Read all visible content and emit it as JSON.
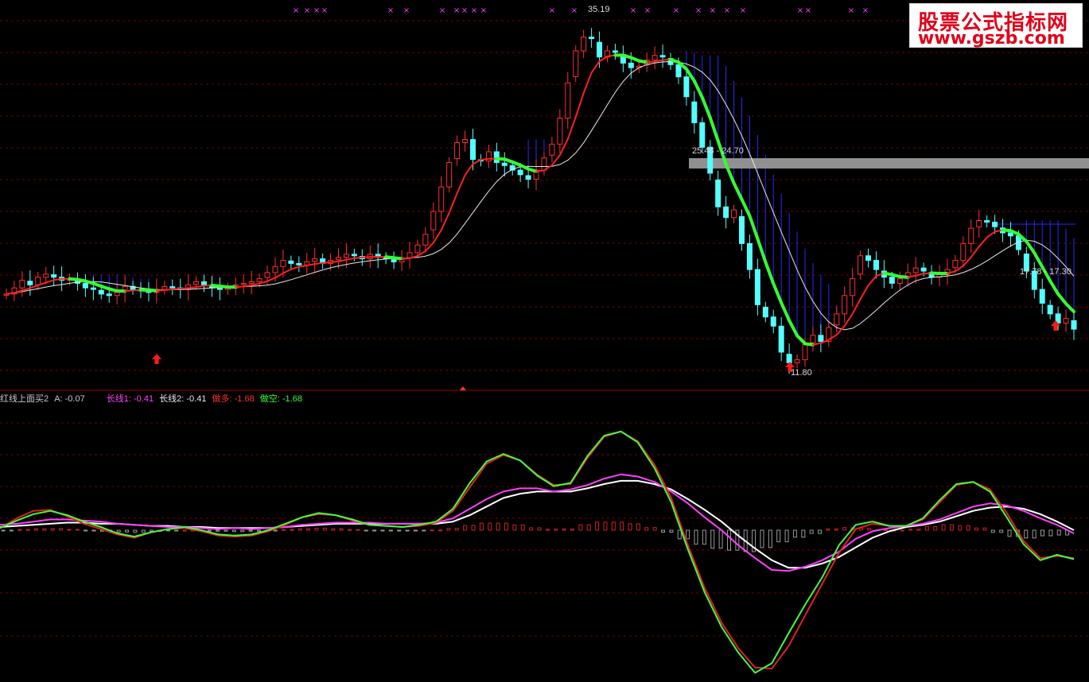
{
  "logo": {
    "line1": "股票公式指标网",
    "line2": "www.gszb.com"
  },
  "status": {
    "title": "红线上面买2",
    "a": "A: -0.07",
    "long1": "长线1: -0.41",
    "long2": "长线2: -0.41",
    "buy": "做多: -1.68",
    "sell": "做空: -1.68"
  },
  "annotations": {
    "high": "35.19",
    "low": "11.80",
    "zone1": "25.48 - 24.70",
    "zone2": "17.78 - 17.30"
  },
  "colors": {
    "up": "#ff3030",
    "down": "#54ffff",
    "fast_red": "#ff2020",
    "fast_green": "#33ff33",
    "slow": "#e8e8e8",
    "band": "#2828ff",
    "grid": "#7a0000",
    "magenta": "#ff40ff",
    "orange": "#ff9020"
  },
  "chart_data": {
    "type": "candlestick",
    "price_high": 35.19,
    "price_low": 11.8,
    "closes": [
      16.9,
      17.3,
      17.8,
      17.5,
      18.0,
      18.2,
      18.0,
      17.8,
      17.9,
      17.6,
      17.3,
      17.2,
      16.9,
      16.8,
      17.0,
      17.4,
      17.2,
      17.1,
      17.0,
      17.2,
      17.4,
      17.3,
      17.2,
      17.5,
      17.7,
      17.5,
      17.3,
      17.2,
      17.3,
      17.5,
      17.6,
      17.7,
      17.9,
      18.3,
      18.7,
      19.1,
      18.9,
      18.8,
      19.0,
      19.2,
      18.9,
      19.1,
      19.3,
      19.5,
      19.4,
      19.2,
      19.5,
      19.3,
      19.2,
      19.0,
      19.2,
      19.6,
      20.1,
      20.8,
      22.3,
      23.9,
      25.5,
      26.8,
      27.0,
      25.7,
      25.6,
      26.2,
      25.5,
      25.3,
      25.0,
      24.7,
      24.4,
      25.0,
      25.8,
      26.7,
      28.4,
      30.7,
      32.8,
      33.7,
      33.6,
      32.4,
      32.8,
      32.7,
      32.0,
      31.7,
      31.8,
      32.2,
      32.5,
      32.4,
      31.9,
      31.1,
      29.8,
      28.1,
      26.5,
      24.8,
      22.6,
      21.9,
      22.4,
      20.2,
      18.5,
      16.2,
      15.4,
      14.8,
      13.1,
      12.4,
      12.6,
      13.6,
      14.2,
      13.8,
      14.7,
      15.6,
      16.8,
      17.9,
      19.4,
      19.1,
      18.5,
      18.0,
      17.6,
      17.9,
      18.3,
      18.6,
      18.4,
      18.0,
      18.2,
      18.5,
      19.1,
      20.2,
      21.2,
      21.7,
      21.6,
      21.3,
      20.9,
      20.7,
      19.8,
      18.4,
      17.2,
      16.3,
      15.6,
      15.0,
      15.3,
      14.6
    ]
  },
  "oscillator": {
    "fast1": [
      0.2,
      0.9,
      1.5,
      1.8,
      1.4,
      0.8,
      0.3,
      -0.3,
      -0.6,
      -0.2,
      0.1,
      0.3,
      0.0,
      -0.4,
      -0.5,
      -0.4,
      0.0,
      0.6,
      1.2,
      1.6,
      1.4,
      1.0,
      0.5,
      0.4,
      0.3,
      0.5,
      0.8,
      2.0,
      4.4,
      6.4,
      7.1,
      6.5,
      5.1,
      4.1,
      4.4,
      6.9,
      8.8,
      9.2,
      8.2,
      5.8,
      2.6,
      -1.8,
      -5.8,
      -9.0,
      -11.4,
      -13.3,
      -12.4,
      -9.6,
      -6.9,
      -4.4,
      -1.4,
      0.5,
      0.8,
      0.4,
      0.4,
      1.1,
      2.8,
      4.3,
      4.5,
      3.6,
      1.2,
      -1.3,
      -2.8,
      -2.3,
      -2.7
    ],
    "fast2": [
      0.2,
      1.1,
      1.8,
      1.9,
      1.3,
      0.6,
      0.1,
      -0.4,
      -0.7,
      -0.2,
      0.1,
      0.2,
      -0.1,
      -0.5,
      -0.6,
      -0.5,
      -0.1,
      0.5,
      1.2,
      1.5,
      1.4,
      0.9,
      0.5,
      0.4,
      0.3,
      0.4,
      0.7,
      1.8,
      4.0,
      6.2,
      7.0,
      6.5,
      5.2,
      4.2,
      4.3,
      6.7,
      8.7,
      9.2,
      8.3,
      6.1,
      3.0,
      -1.4,
      -5.4,
      -8.6,
      -11.0,
      -12.8,
      -12.9,
      -10.8,
      -7.9,
      -5.0,
      -2.1,
      0.1,
      0.6,
      0.4,
      0.4,
      1.0,
      2.6,
      4.2,
      4.5,
      3.8,
      1.6,
      -1.0,
      -2.6,
      -2.4,
      -2.6
    ],
    "long1": [
      0.5,
      0.6,
      0.8,
      1.0,
      1.0,
      0.9,
      0.8,
      0.6,
      0.5,
      0.4,
      0.3,
      0.3,
      0.2,
      0.1,
      0.2,
      0.1,
      0.2,
      0.3,
      0.5,
      0.6,
      0.7,
      0.7,
      0.7,
      0.6,
      0.6,
      0.6,
      0.7,
      1.1,
      2.0,
      2.9,
      3.6,
      3.9,
      3.9,
      3.6,
      3.8,
      4.2,
      4.8,
      5.2,
      5.0,
      4.5,
      3.6,
      2.5,
      1.2,
      0.0,
      -1.4,
      -2.6,
      -3.7,
      -3.8,
      -3.4,
      -2.8,
      -2.0,
      -0.8,
      -0.1,
      0.2,
      0.4,
      0.6,
      1.0,
      1.6,
      2.2,
      2.5,
      2.3,
      1.8,
      1.1,
      0.5,
      -0.3
    ],
    "long2": [
      0.3,
      0.4,
      0.5,
      0.6,
      0.7,
      0.7,
      0.6,
      0.6,
      0.5,
      0.4,
      0.4,
      0.3,
      0.3,
      0.2,
      0.2,
      0.2,
      0.2,
      0.3,
      0.4,
      0.5,
      0.6,
      0.6,
      0.6,
      0.6,
      0.6,
      0.6,
      0.6,
      0.8,
      1.4,
      2.2,
      3.0,
      3.4,
      3.6,
      3.6,
      3.6,
      3.9,
      4.3,
      4.6,
      4.6,
      4.3,
      3.8,
      2.9,
      1.9,
      0.8,
      -0.5,
      -1.7,
      -2.8,
      -3.5,
      -3.5,
      -3.1,
      -2.5,
      -1.6,
      -0.7,
      -0.1,
      0.3,
      0.5,
      0.8,
      1.3,
      1.8,
      2.1,
      2.2,
      2.0,
      1.5,
      0.8,
      0.0
    ]
  }
}
